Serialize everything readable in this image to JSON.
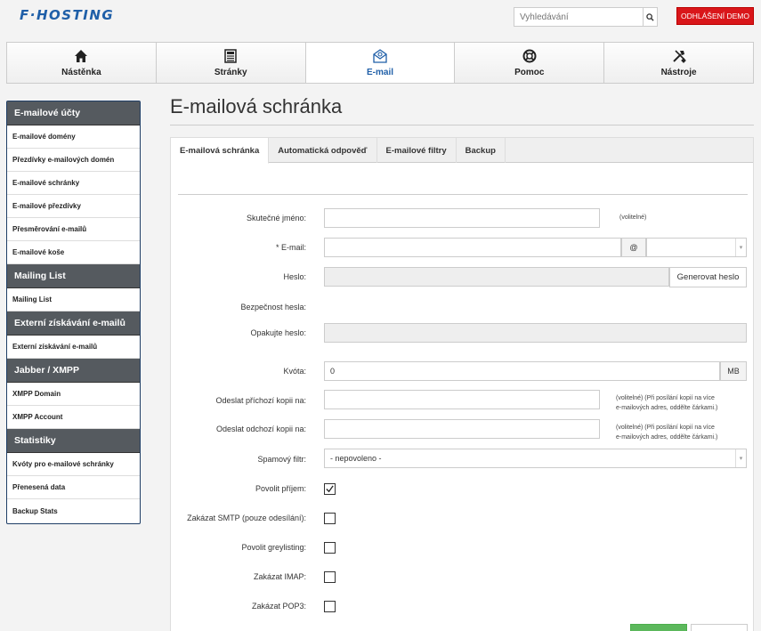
{
  "header": {
    "logo": "F·HOSTING",
    "search_placeholder": "Vyhledávání",
    "logout_label": "ODHLÁŠENÍ DEMO"
  },
  "nav": {
    "items": [
      {
        "label": "Nástěnka",
        "icon": "home-icon"
      },
      {
        "label": "Stránky",
        "icon": "pages-icon"
      },
      {
        "label": "E-mail",
        "icon": "email-icon",
        "active": true
      },
      {
        "label": "Pomoc",
        "icon": "lifebuoy-icon"
      },
      {
        "label": "Nástroje",
        "icon": "tools-icon"
      }
    ]
  },
  "sidebar": {
    "sections": [
      {
        "title": "E-mailové účty",
        "items": [
          "E-mailové domény",
          "Přezdívky e-mailových domén",
          "E-mailové schránky",
          "E-mailové přezdívky",
          "Přesměrování e-mailů",
          "E-mailové koše"
        ]
      },
      {
        "title": "Mailing List",
        "items": [
          "Mailing List"
        ]
      },
      {
        "title": "Externí získávání e-mailů",
        "items": [
          "Externí získávání e-mailů"
        ]
      },
      {
        "title": "Jabber / XMPP",
        "items": [
          "XMPP Domain",
          "XMPP Account"
        ]
      },
      {
        "title": "Statistiky",
        "items": [
          "Kvóty pro e-mailové schránky",
          "Přenesená data",
          "Backup Stats"
        ]
      }
    ]
  },
  "main": {
    "title": "E-mailová schránka",
    "tabs": [
      "E-mailová schránka",
      "Automatická odpověď",
      "E-mailové filtry",
      "Backup"
    ],
    "form": {
      "real_name_label": "Skutečné jméno:",
      "optional": "(volitelné)",
      "email_label": "* E-mail:",
      "at_sign": "@",
      "password_label": "Heslo:",
      "generate_password": "Generovat heslo",
      "password_strength_label": "Bezpečnost hesla:",
      "repeat_password_label": "Opakujte heslo:",
      "quota_label": "Kvóta:",
      "quota_value": "0",
      "quota_unit": "MB",
      "copy_incoming_label": "Odeslat příchozí kopii na:",
      "copy_outgoing_label": "Odeslat odchozí kopii na:",
      "copy_hint_line1": "(volitelné) (Při posílání kopií na více",
      "copy_hint_line2": "e-mailových adres, oddělte čárkami.)",
      "spam_filter_label": "Spamový filtr:",
      "spam_filter_value": "- nepovoleno -",
      "allow_receive_label": "Povolit příjem:",
      "allow_receive_checked": true,
      "disable_smtp_label": "Zakázat SMTP (pouze odesílání):",
      "greylisting_label": "Povolit greylisting:",
      "disable_imap_label": "Zakázat IMAP:",
      "disable_pop3_label": "Zakázat POP3:"
    }
  }
}
